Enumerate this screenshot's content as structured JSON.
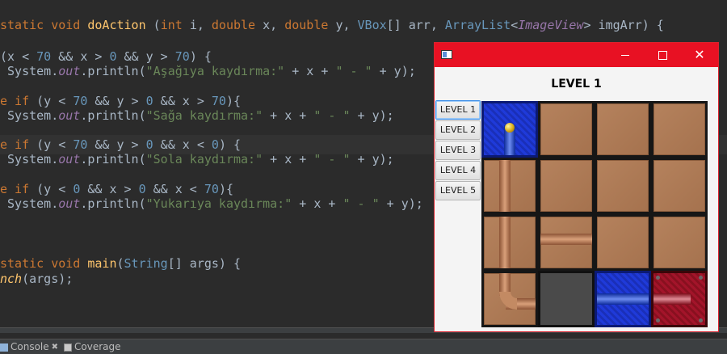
{
  "editor": {
    "lines": [
      {
        "id": "l1",
        "text": "static void doAction (int i, double x, double y, VBox[] arr, ArrayList<ImageView> imgArr) {"
      },
      {
        "id": "l2",
        "text": "(x < 70 && x > 0 && y > 70) {"
      },
      {
        "id": "l3",
        "text": "System.out.println(\"Aşağıya kaydırma:\" + x + \" - \" + y);"
      },
      {
        "id": "l4",
        "text": "e if (y < 70 && y > 0 && x > 70){"
      },
      {
        "id": "l5",
        "text": "System.out.println(\"Sağa kaydırma:\" + x + \" - \" + y);"
      },
      {
        "id": "l6",
        "text": "e if (y < 70 && y > 0 && x < 0) {"
      },
      {
        "id": "l7",
        "text": "System.out.println(\"Sola kaydırma:\" + x + \" - \" + y);"
      },
      {
        "id": "l8",
        "text": "e if (y < 0 && x > 0 && x < 70){"
      },
      {
        "id": "l9",
        "text": "System.out.println(\"Yukarıya kaydırma:\" + x + \" - \" + y);"
      },
      {
        "id": "l10",
        "text": "static void main(String[] args) {"
      },
      {
        "id": "l11",
        "text": "nch(args);"
      }
    ]
  },
  "bottom_bar": {
    "console_label": "Console",
    "console_close": "✖",
    "coverage_label": "Coverage"
  },
  "window": {
    "title": "",
    "controls": {
      "minimize": "minimize",
      "maximize": "maximize",
      "close": "✕"
    },
    "level_title": "LEVEL 1",
    "level_buttons": [
      "LEVEL 1",
      "LEVEL 2",
      "LEVEL 3",
      "LEVEL 4",
      "LEVEL 5"
    ],
    "active_level": 1
  },
  "board": {
    "rows": 4,
    "cols": 4,
    "tiles": [
      [
        "blue-start",
        "brown",
        "brown",
        "brown"
      ],
      [
        "brown-pipe-vertical",
        "brown",
        "brown",
        "brown"
      ],
      [
        "brown-pipe-vertical",
        "brown-pipe-horizontal",
        "brown",
        "brown"
      ],
      [
        "brown-pipe-curve",
        "gray-empty",
        "blue-pipe-horizontal",
        "red-end"
      ]
    ]
  },
  "colors": {
    "editor_bg": "#2b2b2b",
    "keyword": "#cc7832",
    "string": "#6a8759",
    "number": "#6897bb",
    "field": "#9876aa",
    "titlebar": "#e81123"
  }
}
